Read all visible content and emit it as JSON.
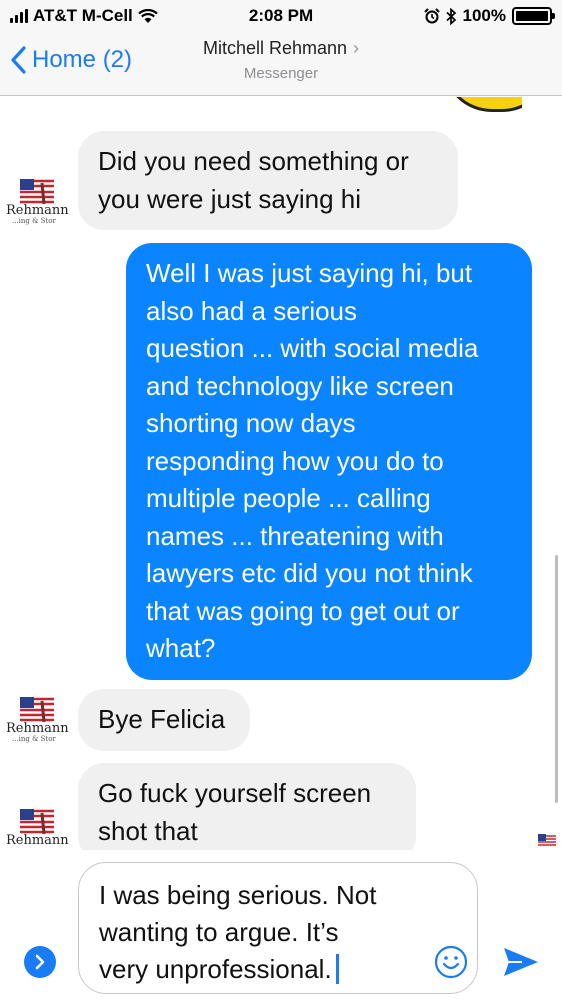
{
  "status_bar": {
    "carrier": "AT&T M-Cell",
    "time": "2:08 PM",
    "battery": "100%",
    "battery_level": 1.0
  },
  "header": {
    "back_label": "Home (2)",
    "contact_name": "Mitchell Rehmann",
    "subtitle": "Messenger"
  },
  "avatar": {
    "logo_text": "Rehmann",
    "logo_small": "...ing & Stor"
  },
  "messages": [
    {
      "direction": "incoming",
      "lines": [
        "Did you need something or",
        "you were just saying hi"
      ]
    },
    {
      "direction": "outgoing",
      "lines": [
        "Well I was just saying hi, but",
        "also had a serious",
        "question ... with social media",
        "and technology like screen",
        "shorting now days",
        "responding how you do to",
        "multiple people ... calling",
        "names ... threatening with",
        "lawyers etc did you not think",
        "that was going to get out or",
        "what?"
      ]
    },
    {
      "direction": "incoming",
      "lines": [
        "Bye Felicia"
      ]
    },
    {
      "direction": "incoming",
      "lines": [
        "Go fuck yourself screen",
        "shot that"
      ]
    }
  ],
  "composer": {
    "draft_lines": [
      "I was being serious. Not",
      "wanting to argue. It’s",
      "very unprofessional."
    ]
  },
  "colors": {
    "accent": "#1a7cf5",
    "outgoing_bubble": "#0a84ff",
    "incoming_bubble": "#f0f0f0",
    "bar_background": "#f7f7f7"
  },
  "icons": {
    "back": "chevron-left-icon",
    "wifi": "wifi-icon",
    "alarm": "alarm-icon",
    "bluetooth": "bluetooth-icon",
    "emoji": "smiley-icon",
    "send": "send-arrow-icon",
    "expand": "chevron-right-icon"
  }
}
